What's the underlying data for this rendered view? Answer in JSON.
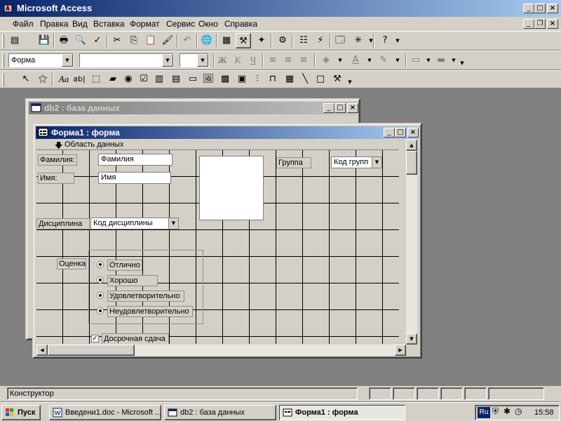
{
  "app": {
    "title": "Microsoft Access",
    "accent": "#0a246a"
  },
  "menu": [
    "Файл",
    "Правка",
    "Вид",
    "Вставка",
    "Формат",
    "Сервис",
    "Окно",
    "Справка"
  ],
  "format_toolbar": {
    "object_combo": "Форма"
  },
  "db_window": {
    "title": "db2 : база данных"
  },
  "form_window": {
    "title": "Форма1 : форма",
    "section_header": "Область данных"
  },
  "form": {
    "familia_label": "Фамилия:",
    "familia_field": "Фамилия",
    "imya_label": "Имя:",
    "imya_field": "Имя",
    "gruppa_label": "Группа",
    "gruppa_combo": "Код групп",
    "disciplina_label": "Дисциплина",
    "disciplina_combo": "Код дисциплины",
    "ocenka_label": "Оценка",
    "options": [
      "Отлично",
      "Хорошо",
      "Удовлетворительно",
      "Неудовлетворительно"
    ],
    "checkbox_label": "Досрочная сдача"
  },
  "status": {
    "text": "Конструктор"
  },
  "taskbar": {
    "start": "Пуск",
    "tasks": [
      "Введени1.doc - Microsoft ...",
      "db2 : база данных",
      "Форма1 : форма"
    ],
    "lang": "Ru",
    "clock": "15:58"
  }
}
